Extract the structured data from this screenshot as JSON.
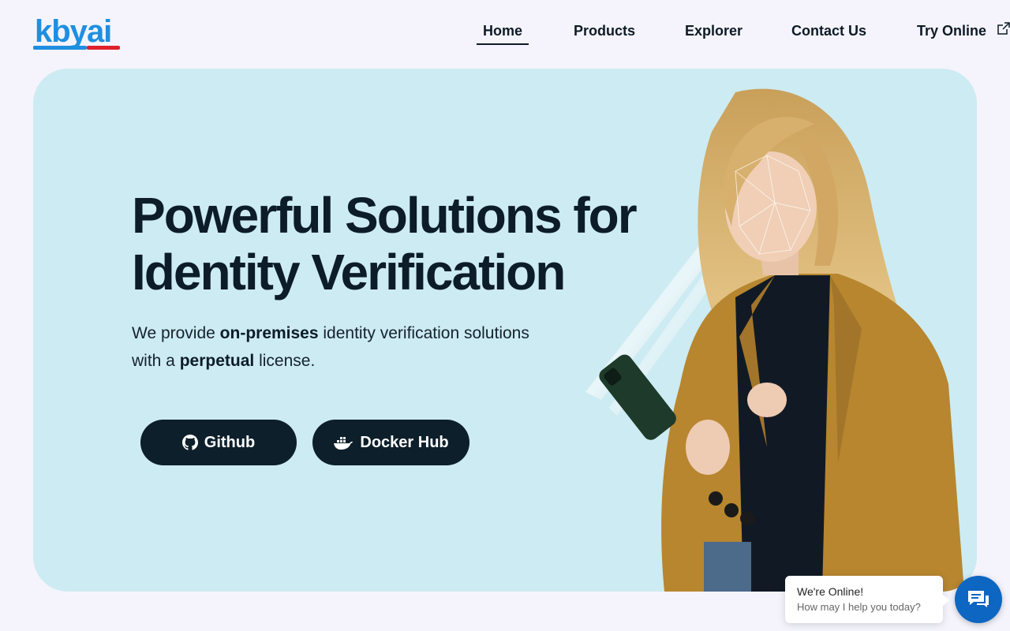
{
  "brand": {
    "logo_text_1": "kby",
    "logo_text_2": "ai"
  },
  "nav": {
    "items": [
      {
        "label": "Home",
        "active": true
      },
      {
        "label": "Products"
      },
      {
        "label": "Explorer"
      },
      {
        "label": "Contact Us"
      },
      {
        "label": "Try Online"
      }
    ]
  },
  "hero": {
    "title_line1": "Powerful Solutions for",
    "title_line2": "Identity Verification",
    "subtitle_part1": "We provide ",
    "subtitle_bold1": "on-premises",
    "subtitle_part2": " identity verification solutions",
    "subtitle_part3": "with a ",
    "subtitle_bold2": "perpetual",
    "subtitle_part4": " license.",
    "buttons": {
      "github_label": "Github",
      "docker_label": "Docker Hub"
    }
  },
  "chat": {
    "title": "We're Online!",
    "text": "How may I help you today?"
  },
  "colors": {
    "background": "#f5f4fc",
    "hero_bg": "#cdebf2",
    "button_bg": "#0d1f2b",
    "brand_blue": "#1f8fe0",
    "brand_red": "#e0202a",
    "chat_blue": "#0d66c2",
    "coat": "#b7862f"
  }
}
